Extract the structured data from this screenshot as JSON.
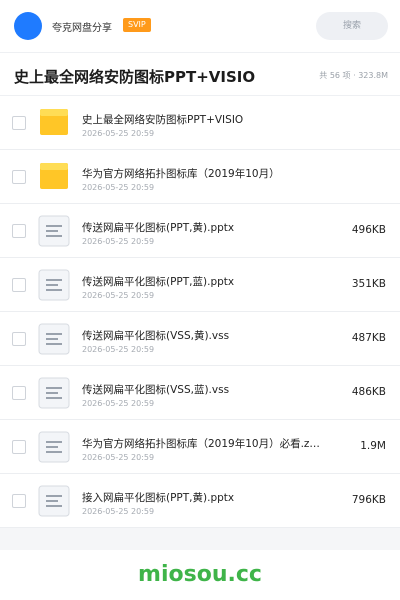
{
  "topbar": {
    "share_title": "夸克网盘分享",
    "badge": "SVIP",
    "search_label": "搜索"
  },
  "header": {
    "title": "史上最全网络安防图标PPT+VISIO",
    "meta": "共 56 项 · 323.8M"
  },
  "files": [
    {
      "name": "史上最全网络安防图标PPT+VISIO",
      "date": "2026-05-25 20:59",
      "size": "",
      "type": "folder"
    },
    {
      "name": "华为官方网络拓扑图标库（2019年10月）",
      "date": "2026-05-25 20:59",
      "size": "",
      "type": "folder"
    },
    {
      "name": "传送网扁平化图标(PPT,黄).pptx",
      "date": "2026-05-25 20:59",
      "size": "496KB",
      "type": "document"
    },
    {
      "name": "传送网扁平化图标(PPT,蓝).pptx",
      "date": "2026-05-25 20:59",
      "size": "351KB",
      "type": "document"
    },
    {
      "name": "传送网扁平化图标(VSS,黄).vss",
      "date": "2026-05-25 20:59",
      "size": "487KB",
      "type": "document"
    },
    {
      "name": "传送网扁平化图标(VSS,蓝).vss",
      "date": "2026-05-25 20:59",
      "size": "486KB",
      "type": "document"
    },
    {
      "name": "华为官方网络拓扑图标库（2019年10月）必看.z…",
      "date": "2026-05-25 20:59",
      "size": "1.9M",
      "type": "document"
    },
    {
      "name": "接入网扁平化图标(PPT,黄).pptx",
      "date": "2026-05-25 20:59",
      "size": "796KB",
      "type": "document"
    }
  ],
  "footer": {
    "watermark": "miosou.cc"
  },
  "colors": {
    "accent": "#1f7bff",
    "svip": "#ff9a1a",
    "folder": "#ffc627",
    "watermark": "#3fb449"
  }
}
